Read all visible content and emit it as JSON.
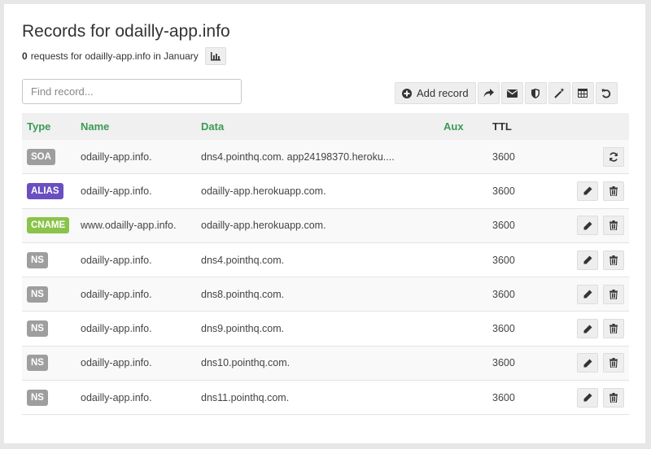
{
  "header": {
    "title": "Records for odailly-app.info",
    "request_count": "0",
    "request_text": "requests for odailly-app.info in January",
    "stats_icon": "bar-chart-icon"
  },
  "search": {
    "placeholder": "Find record..."
  },
  "toolbar": {
    "add_label": "Add record",
    "icons": [
      "plus-circle-icon",
      "share-icon",
      "envelope-icon",
      "shield-icon",
      "magic-wand-icon",
      "table-icon",
      "undo-icon"
    ]
  },
  "table": {
    "headers": {
      "type": "Type",
      "name": "Name",
      "data": "Data",
      "aux": "Aux",
      "ttl": "TTL"
    },
    "rows": [
      {
        "type": "SOA",
        "color": "#9e9e9e",
        "name": "odailly-app.info.",
        "data": "dns4.pointhq.com. app24198370.heroku....",
        "aux": "",
        "ttl": "3600"
      },
      {
        "type": "ALIAS",
        "color": "#6a4fc1",
        "name": "odailly-app.info.",
        "data": "odailly-app.herokuapp.com.",
        "aux": "",
        "ttl": "3600"
      },
      {
        "type": "CNAME",
        "color": "#8bc34a",
        "name": "www.odailly-app.info.",
        "data": "odailly-app.herokuapp.com.",
        "aux": "",
        "ttl": "3600"
      },
      {
        "type": "NS",
        "color": "#9e9e9e",
        "name": "odailly-app.info.",
        "data": "dns4.pointhq.com.",
        "aux": "",
        "ttl": "3600"
      },
      {
        "type": "NS",
        "color": "#9e9e9e",
        "name": "odailly-app.info.",
        "data": "dns8.pointhq.com.",
        "aux": "",
        "ttl": "3600"
      },
      {
        "type": "NS",
        "color": "#9e9e9e",
        "name": "odailly-app.info.",
        "data": "dns9.pointhq.com.",
        "aux": "",
        "ttl": "3600"
      },
      {
        "type": "NS",
        "color": "#9e9e9e",
        "name": "odailly-app.info.",
        "data": "dns10.pointhq.com.",
        "aux": "",
        "ttl": "3600"
      },
      {
        "type": "NS",
        "color": "#9e9e9e",
        "name": "odailly-app.info.",
        "data": "dns11.pointhq.com.",
        "aux": "",
        "ttl": "3600"
      }
    ]
  }
}
